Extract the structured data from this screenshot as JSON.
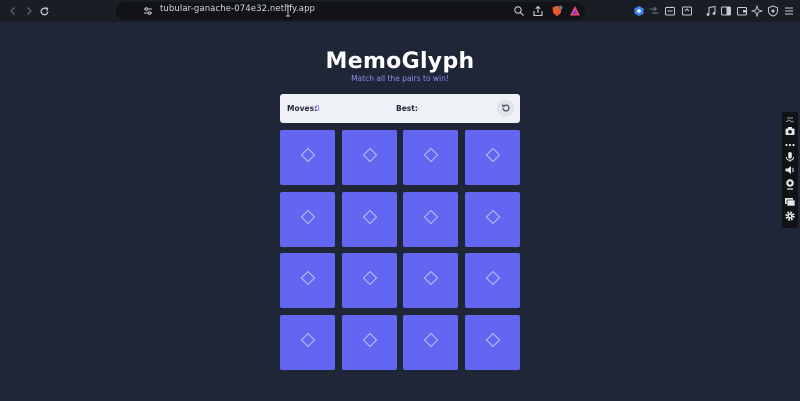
{
  "browser": {
    "url": "tubular-ganache-074e32.netlify.app",
    "icons": {
      "back": "back-arrow-icon",
      "forward": "forward-arrow-icon",
      "reload": "reload-icon",
      "bookmark": "bookmark-icon",
      "site_settings": "site-settings-icon",
      "zoom": "zoom-icon",
      "share": "share-icon",
      "shields": "brave-shields-icon",
      "rewards": "brave-rewards-icon"
    },
    "colors": {
      "toolbar": "#1a1d24",
      "urlbar": "#111318"
    }
  },
  "app": {
    "title": "MemoGlyph",
    "subtitle": "Match all the pairs to win!",
    "score": {
      "moves_label": "Moves:",
      "moves_value": "0",
      "best_label": "Best:",
      "best_value": "-"
    },
    "reset_icon": "reset-icon",
    "cards_face_down": 16,
    "card_icon": "diamond-icon",
    "colors": {
      "background": "#1e2638",
      "card": "#6366f1",
      "accent": "#8b8ff0",
      "scorebar": "#eef1f6"
    }
  }
}
